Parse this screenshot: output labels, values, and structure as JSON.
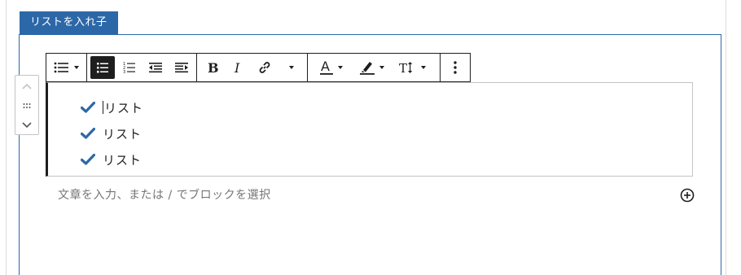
{
  "block_title": "リストを入れ子",
  "toolbar": {
    "groups": [
      [
        "list-style-icon"
      ],
      [
        "unordered-list-icon",
        "ordered-list-icon",
        "outdent-icon",
        "indent-icon"
      ],
      [
        "bold-icon",
        "italic-icon",
        "link-icon",
        "more-formatting-icon"
      ],
      [
        "text-color-icon",
        "highlight-icon",
        "font-size-icon"
      ],
      [
        "options-icon"
      ]
    ],
    "active": "unordered-list-icon"
  },
  "list": {
    "items": [
      {
        "text": "リスト"
      },
      {
        "text": "リスト"
      },
      {
        "text": "リスト"
      }
    ],
    "marker_icon": "checkmark-icon"
  },
  "placeholder": "文章を入力、または / でブロックを選択",
  "colors": {
    "accent": "#2c68a8",
    "toolbar_border": "#1e1e1e",
    "text": "#1e1e1e",
    "placeholder": "#757575"
  }
}
